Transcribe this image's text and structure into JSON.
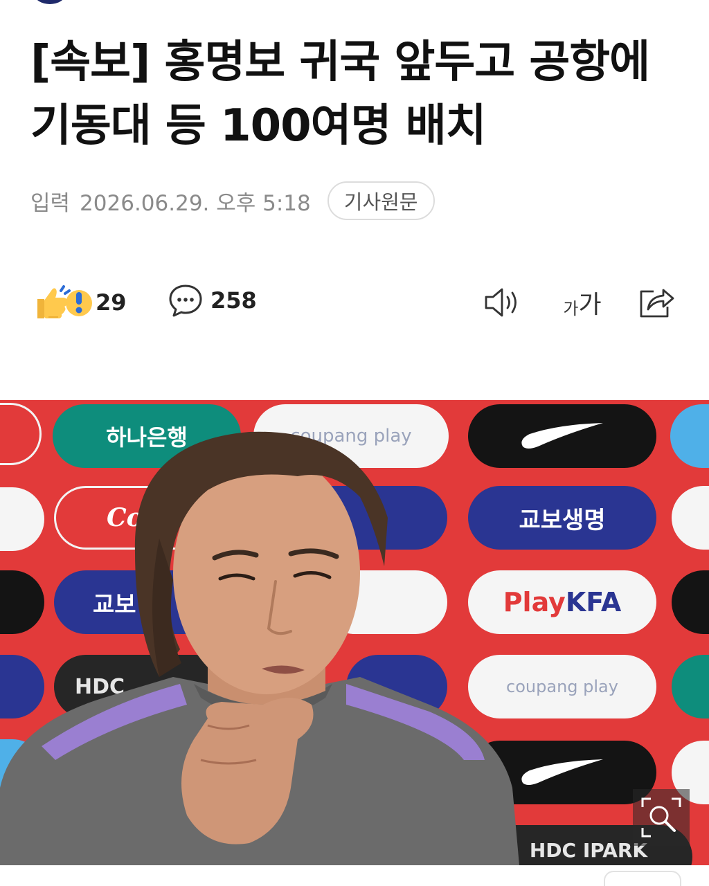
{
  "article": {
    "headline": "[속보] 홍명보 귀국 앞두고 공항에 기동대 등 100여명 배치",
    "meta": {
      "label": "입력",
      "datetime": "2026.06.29. 오후 5:18",
      "original_button": "기사원문"
    }
  },
  "actions": {
    "reaction_count": "29",
    "comment_count": "258",
    "font_small": "가",
    "font_large": "가"
  },
  "photo": {
    "sponsors": {
      "hana": "하나은행",
      "coupang": "coupang play",
      "kyobo": "교보생명",
      "kyobo_partial": "교보",
      "playkfa_play": "Play",
      "playkfa_kfa": "KFA",
      "coupang_lower": "coupang play",
      "hdc": "HDC",
      "hdc_ipark": "HDC IPARK",
      "coca": "Coca"
    }
  },
  "colors": {
    "backdrop_red": "#e23a3a",
    "kfa_navy": "#2a3592",
    "hana_teal": "#0e8d7c",
    "shirt_gray": "#6b6b6b",
    "shirt_accent": "#9a7fd1"
  },
  "icons": [
    "thumbs-up-surprise-icon",
    "comment-icon",
    "audio-icon",
    "font-size-icon",
    "share-icon",
    "zoom-icon"
  ]
}
